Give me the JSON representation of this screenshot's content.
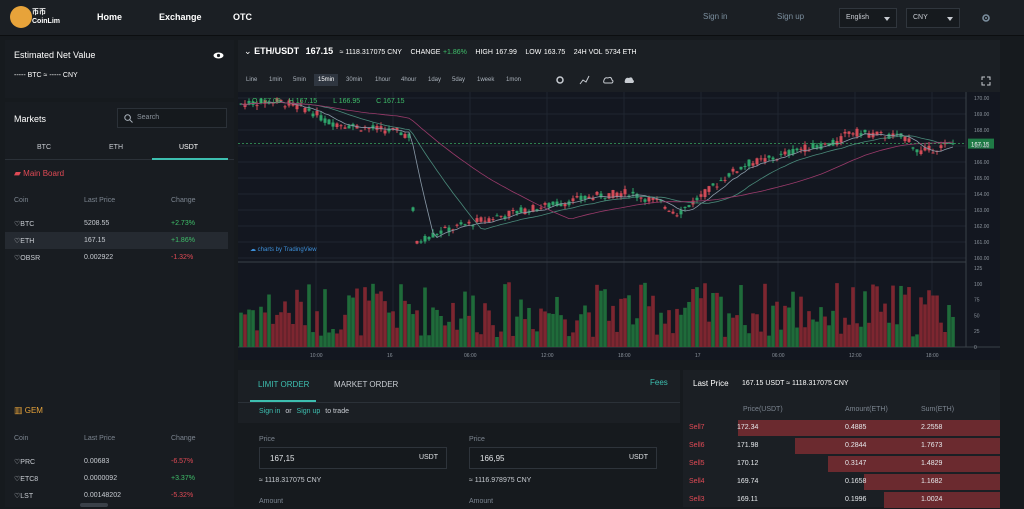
{
  "brand": {
    "name_cn": "币币",
    "name_en": "CoinLim"
  },
  "nav": [
    "Home",
    "Exchange",
    "OTC"
  ],
  "top_links": {
    "signin": "Sign in",
    "signup": "Sign up"
  },
  "selects": {
    "language": "English",
    "currency": "CNY"
  },
  "estimated": {
    "title": "Estimated Net Value",
    "value": "----- BTC ≈ ----- CNY"
  },
  "markets": {
    "title": "Markets",
    "search_placeholder": "Search",
    "tabs": [
      "BTC",
      "ETH",
      "USDT"
    ],
    "board1": "Main Board",
    "headers": [
      "Coin",
      "Last Price",
      "Change"
    ],
    "rows1": [
      {
        "coin": "BTC",
        "price": "5208.55",
        "change": "+2.73%"
      },
      {
        "coin": "ETH",
        "price": "167.15",
        "change": "+1.86%"
      },
      {
        "coin": "OBSR",
        "price": "0.002922",
        "change": "-1.32%"
      }
    ],
    "board2": "GEM",
    "rows2": [
      {
        "coin": "PRC",
        "price": "0.00683",
        "change": "-6.57%"
      },
      {
        "coin": "ETC8",
        "price": "0.0000092",
        "change": "+3.37%"
      },
      {
        "coin": "LST",
        "price": "0.00148202",
        "change": "-5.32%"
      }
    ]
  },
  "ticker": {
    "pair": "ETH/USDT",
    "price": "167.15",
    "cny": "≈ 1118.317075 CNY",
    "change_label": "CHANGE",
    "change": "+1.86%",
    "high_label": "HIGH",
    "high": "167.99",
    "low_label": "LOW",
    "low": "163.75",
    "vol_label": "24H VOL",
    "vol": "5734 ETH"
  },
  "chart_toolbar": [
    "Line",
    "1min",
    "5min",
    "15min",
    "30min",
    "1hour",
    "4hour",
    "1day",
    "5day",
    "1week",
    "1mon"
  ],
  "chart_overlay": {
    "h": "H 167.15",
    "l": "L 166.95",
    "c": "C 167.15",
    "o": "O 167.08",
    "watermark": "charts by TradingView"
  },
  "chart_data": {
    "type": "candlestick",
    "price_axis": [
      "170.00",
      "169.00",
      "168.00",
      "167.00",
      "166.00",
      "165.00",
      "164.00",
      "163.00",
      "162.00",
      "161.00",
      "160.00"
    ],
    "volume_axis": [
      "125",
      "100",
      "75",
      "50",
      "25",
      "0"
    ],
    "time_axis": [
      "10:00",
      "16",
      "06:00",
      "12:00",
      "18:00",
      "17",
      "06:00",
      "12:00",
      "18:00"
    ],
    "last_price_tag": "167.15",
    "ylim": [
      160,
      170
    ]
  },
  "order": {
    "tab_limit": "LIMIT ORDER",
    "tab_market": "MARKET ORDER",
    "fees": "Fees",
    "signin": "Sign in",
    "or": "or",
    "signup": "Sign up",
    "to_trade": "to trade",
    "buy": {
      "label": "Price",
      "value": "167,15",
      "unit": "USDT",
      "approx": "≈ 1118.317075 CNY",
      "amount_label": "Amount"
    },
    "sell": {
      "label": "Price",
      "value": "166,95",
      "unit": "USDT",
      "approx": "≈ 1116.978975 CNY",
      "amount_label": "Amount"
    }
  },
  "book": {
    "title": "Last Price",
    "last": "167.15 USDT ≈ 1118.317075 CNY",
    "headers": [
      "Price(USDT)",
      "Amount(ETH)",
      "Sum(ETH)"
    ],
    "rows": [
      {
        "label": "Sell7",
        "price": "172.34",
        "amount": "0.4885",
        "sum": "2.2558"
      },
      {
        "label": "Sell6",
        "price": "171.98",
        "amount": "0.2844",
        "sum": "1.7673"
      },
      {
        "label": "Sell5",
        "price": "170.12",
        "amount": "0.3147",
        "sum": "1.4829"
      },
      {
        "label": "Sell4",
        "price": "169.74",
        "amount": "0.1658",
        "sum": "1.1682"
      },
      {
        "label": "Sell3",
        "price": "169.11",
        "amount": "0.1996",
        "sum": "1.0024"
      }
    ]
  },
  "colors": {
    "accent": "#3dbfb0",
    "up": "#3fbf6a",
    "down": "#e04a55",
    "gem": "#e7a33a"
  }
}
